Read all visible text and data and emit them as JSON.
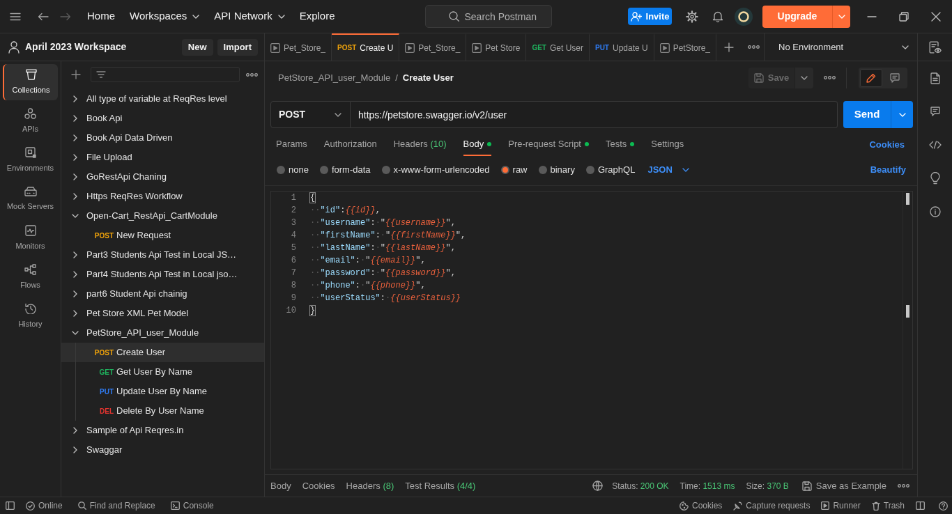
{
  "topbar": {
    "nav": [
      {
        "label": "Home",
        "dropdown": false
      },
      {
        "label": "Workspaces",
        "dropdown": true
      },
      {
        "label": "API Network",
        "dropdown": true
      },
      {
        "label": "Explore",
        "dropdown": false
      }
    ],
    "search": {
      "placeholder": "Search Postman"
    },
    "invite": "Invite",
    "upgrade": "Upgrade"
  },
  "workspace": {
    "name": "April 2023 Workspace",
    "buttons": [
      "New",
      "Import"
    ]
  },
  "tabs": [
    {
      "kind": "runner",
      "label": "Pet_Store_",
      "selected": false
    },
    {
      "kind": "request",
      "method": "POST",
      "color": "#f0a30a",
      "label": "Create U",
      "selected": true
    },
    {
      "kind": "runner",
      "label": "Pet_Store_",
      "selected": false
    },
    {
      "kind": "runner",
      "label": "Pet Store",
      "selected": false
    },
    {
      "kind": "request",
      "method": "GET",
      "color": "#1fb45e",
      "label": "Get User",
      "selected": false
    },
    {
      "kind": "request",
      "method": "PUT",
      "color": "#2f7df6",
      "label": "Update U",
      "selected": false
    },
    {
      "kind": "runner",
      "label": "PetStore_",
      "selected": false
    }
  ],
  "environment": {
    "label": "No Environment"
  },
  "nav_rail": [
    {
      "label": "Collections",
      "selected": true
    },
    {
      "label": "APIs",
      "selected": false
    },
    {
      "label": "Environments",
      "selected": false
    },
    {
      "label": "Mock Servers",
      "selected": false
    },
    {
      "label": "Monitors",
      "selected": false
    },
    {
      "label": "Flows",
      "selected": false
    },
    {
      "label": "History",
      "selected": false
    }
  ],
  "sidebar": {
    "collections": [
      {
        "name": "All type of variable at ReqRes level",
        "expanded": false,
        "selected": false
      },
      {
        "name": "Book Api",
        "expanded": false,
        "selected": false
      },
      {
        "name": "Book Api Data Driven",
        "expanded": false,
        "selected": false
      },
      {
        "name": "File Upload",
        "expanded": false,
        "selected": false
      },
      {
        "name": "GoRestApi Chaning",
        "expanded": false,
        "selected": false
      },
      {
        "name": "Https ReqRes Workflow",
        "expanded": false,
        "selected": false
      },
      {
        "name": "Open-Cart_RestApi_CartModule",
        "expanded": true,
        "selected": false,
        "children": [
          {
            "method": "POST",
            "color": "#f0a30a",
            "name": "New Request",
            "selected": false
          }
        ]
      },
      {
        "name": "Part3 Students Api Test in Local JS…",
        "expanded": false,
        "selected": false
      },
      {
        "name": "Part4 Students Api Test in Local jso…",
        "expanded": false,
        "selected": false
      },
      {
        "name": "part6 Student Api chainig",
        "expanded": false,
        "selected": false
      },
      {
        "name": "Pet Store XML Pet Model",
        "expanded": false,
        "selected": false
      },
      {
        "name": "PetStore_API_user_Module",
        "expanded": true,
        "selected": false,
        "children": [
          {
            "method": "POST",
            "color": "#f0a30a",
            "name": "Create User",
            "selected": true
          },
          {
            "method": "GET",
            "color": "#1fb45e",
            "name": "Get User By Name",
            "selected": false
          },
          {
            "method": "PUT",
            "color": "#2f7df6",
            "name": "Update User By Name",
            "selected": false
          },
          {
            "method": "DEL",
            "color": "#e3342f",
            "name": "Delete By User Name",
            "selected": false
          }
        ]
      },
      {
        "name": "Sample of Api Reqres.in",
        "expanded": false,
        "selected": false
      },
      {
        "name": "Swaggar",
        "expanded": false,
        "selected": false
      }
    ]
  },
  "request": {
    "breadcrumb": {
      "parent": "PetStore_API_user_Module",
      "separator": "/",
      "current": "Create User"
    },
    "save": {
      "label": "Save",
      "disabled": true
    },
    "modes": [
      {
        "kind": "edit",
        "selected": true
      },
      {
        "kind": "comments",
        "selected": false
      }
    ],
    "method": "POST",
    "url": "https://petstore.swagger.io/v2/user",
    "send": "Send",
    "tabs": [
      {
        "label": "Params",
        "selected": false,
        "dot": false
      },
      {
        "label": "Authorization",
        "selected": false,
        "dot": false
      },
      {
        "label": "Headers",
        "count": "(10)",
        "selected": false,
        "dot": false
      },
      {
        "label": "Body",
        "selected": true,
        "dot": true
      },
      {
        "label": "Pre-request Script",
        "selected": false,
        "dot": true
      },
      {
        "label": "Tests",
        "selected": false,
        "dot": true
      },
      {
        "label": "Settings",
        "selected": false,
        "dot": false
      }
    ],
    "cookies": "Cookies",
    "body_modes": [
      {
        "label": "none",
        "selected": false
      },
      {
        "label": "form-data",
        "selected": false
      },
      {
        "label": "x-www-form-urlencoded",
        "selected": false
      },
      {
        "label": "raw",
        "selected": true
      },
      {
        "label": "binary",
        "selected": false
      },
      {
        "label": "GraphQL",
        "selected": false
      }
    ],
    "language": "JSON",
    "beautify": "Beautify",
    "editor": {
      "lines": [
        {
          "number": "1",
          "tokens": [
            {
              "kind": "brace",
              "text": "{"
            }
          ]
        },
        {
          "number": "2",
          "tokens": [
            {
              "kind": "ws",
              "text": "··"
            },
            {
              "kind": "key",
              "text": "\"id\""
            },
            {
              "kind": "punct",
              "text": ":"
            },
            {
              "kind": "var",
              "text": "{{id}}"
            },
            {
              "kind": "punct",
              "text": ","
            }
          ]
        },
        {
          "number": "3",
          "tokens": [
            {
              "kind": "ws",
              "text": "··"
            },
            {
              "kind": "key",
              "text": "\"username\""
            },
            {
              "kind": "punct",
              "text": ":"
            },
            {
              "kind": "ws",
              "text": "·"
            },
            {
              "kind": "punct",
              "text": "\""
            },
            {
              "kind": "var",
              "text": "{{username}}"
            },
            {
              "kind": "punct",
              "text": "\","
            }
          ]
        },
        {
          "number": "4",
          "tokens": [
            {
              "kind": "ws",
              "text": "··"
            },
            {
              "kind": "key",
              "text": "\"firstName\""
            },
            {
              "kind": "punct",
              "text": ":"
            },
            {
              "kind": "ws",
              "text": "·"
            },
            {
              "kind": "punct",
              "text": "\""
            },
            {
              "kind": "var",
              "text": "{{firstName}}"
            },
            {
              "kind": "punct",
              "text": "\","
            }
          ]
        },
        {
          "number": "5",
          "tokens": [
            {
              "kind": "ws",
              "text": "··"
            },
            {
              "kind": "key",
              "text": "\"lastName\""
            },
            {
              "kind": "punct",
              "text": ":"
            },
            {
              "kind": "ws",
              "text": "·"
            },
            {
              "kind": "punct",
              "text": "\""
            },
            {
              "kind": "var",
              "text": "{{lastName}}"
            },
            {
              "kind": "punct",
              "text": "\","
            }
          ]
        },
        {
          "number": "6",
          "tokens": [
            {
              "kind": "ws",
              "text": "··"
            },
            {
              "kind": "key",
              "text": "\"email\""
            },
            {
              "kind": "punct",
              "text": ":"
            },
            {
              "kind": "ws",
              "text": "·"
            },
            {
              "kind": "punct",
              "text": "\""
            },
            {
              "kind": "var",
              "text": "{{email}}"
            },
            {
              "kind": "punct",
              "text": "\","
            }
          ]
        },
        {
          "number": "7",
          "tokens": [
            {
              "kind": "ws",
              "text": "··"
            },
            {
              "kind": "key",
              "text": "\"password\""
            },
            {
              "kind": "punct",
              "text": ":"
            },
            {
              "kind": "ws",
              "text": "·"
            },
            {
              "kind": "punct",
              "text": "\""
            },
            {
              "kind": "var",
              "text": "{{password}}"
            },
            {
              "kind": "punct",
              "text": "\","
            }
          ]
        },
        {
          "number": "8",
          "tokens": [
            {
              "kind": "ws",
              "text": "··"
            },
            {
              "kind": "key",
              "text": "\"phone\""
            },
            {
              "kind": "punct",
              "text": ":"
            },
            {
              "kind": "ws",
              "text": "·"
            },
            {
              "kind": "punct",
              "text": "\""
            },
            {
              "kind": "var",
              "text": "{{phone}}"
            },
            {
              "kind": "punct",
              "text": "\","
            }
          ]
        },
        {
          "number": "9",
          "tokens": [
            {
              "kind": "ws",
              "text": "··"
            },
            {
              "kind": "key",
              "text": "\"userStatus\""
            },
            {
              "kind": "punct",
              "text": ":"
            },
            {
              "kind": "ws",
              "text": "·"
            },
            {
              "kind": "var",
              "text": "{{userStatus}}"
            }
          ]
        },
        {
          "number": "10",
          "tokens": [
            {
              "kind": "brace",
              "text": "}"
            }
          ]
        }
      ]
    }
  },
  "response": {
    "tabs": [
      {
        "label": "Body",
        "selected": false
      },
      {
        "label": "Cookies",
        "selected": false
      },
      {
        "label": "Headers",
        "count": "(8)",
        "selected": false
      },
      {
        "label": "Test Results",
        "count": "(4/4)",
        "selected": false
      }
    ],
    "stats": [
      {
        "label": "Status:",
        "value": "200 OK"
      },
      {
        "label": "Time:",
        "value": "1513 ms"
      },
      {
        "label": "Size:",
        "value": "370 B"
      }
    ],
    "save_example": "Save as Example"
  },
  "status_bar": {
    "left": [
      "Online",
      "Find and Replace",
      "Console"
    ],
    "right": [
      "Cookies",
      "Capture requests",
      "Runner",
      "Trash"
    ]
  }
}
